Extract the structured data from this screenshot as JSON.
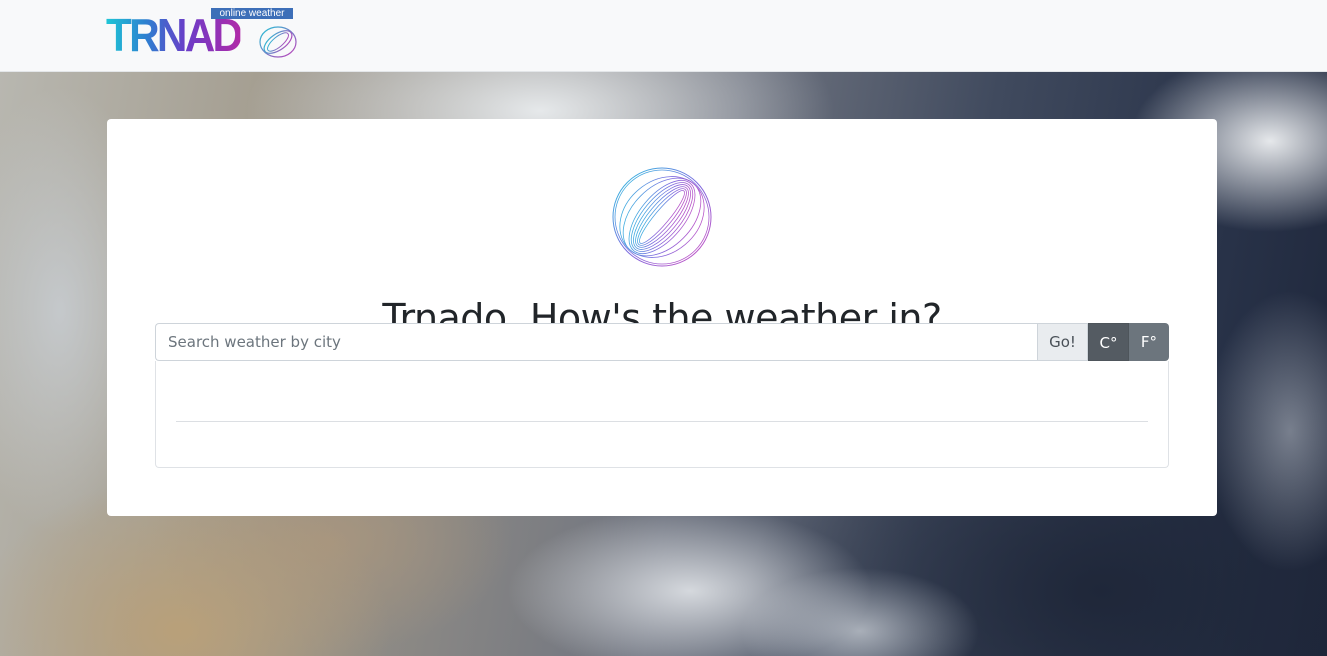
{
  "navbar": {
    "brand": {
      "wordmark": "TRNADO",
      "tagline": "online weather"
    }
  },
  "hero": {
    "title": "Trnado, How's the weather in?"
  },
  "search": {
    "placeholder": "Search weather by city",
    "value": "",
    "go_label": "Go!"
  },
  "units": {
    "celsius_label": "C°",
    "fahrenheit_label": "F°",
    "selected": "celsius"
  },
  "colors": {
    "unit_active": "#545b62",
    "unit_inactive": "#6c757d",
    "brand_gradient_start": "#1fc6d6",
    "brand_gradient_end": "#b02aa8"
  }
}
